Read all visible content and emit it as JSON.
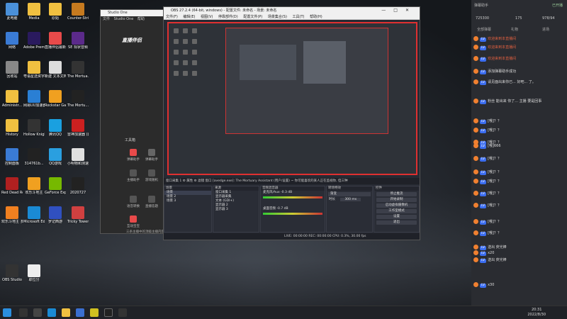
{
  "desktop_icons": [
    {
      "label": "此电脑",
      "color": "#4a90d9"
    },
    {
      "label": "Media",
      "color": "#f0c040"
    },
    {
      "label": "原始",
      "color": "#f0c040"
    },
    {
      "label": "Counter-Strike Global Off...",
      "color": "#c67a1f"
    },
    {
      "label": "网络",
      "color": "#3a7bd5"
    },
    {
      "label": "Adobe Premie...",
      "color": "#2a1a5e"
    },
    {
      "label": "直播伴侣最新",
      "color": "#e84a4a"
    },
    {
      "label": "SE 现状音频",
      "color": "#5b2a8a"
    },
    {
      "label": "回收站",
      "color": "#888888"
    },
    {
      "label": "粤语星选资字",
      "color": "#f0c040"
    },
    {
      "label": "新建 文本文档",
      "color": "#dddddd"
    },
    {
      "label": "The Mortua...",
      "color": "#333333"
    },
    {
      "label": "Administr...",
      "color": "#f0c040"
    },
    {
      "label": "网易UU加速器",
      "color": "#2a7fd4"
    },
    {
      "label": "Rockstar Games...",
      "color": "#f0a020"
    },
    {
      "label": "The Mortu...",
      "color": "#222222"
    },
    {
      "label": "History",
      "color": "#f0c040"
    },
    {
      "label": "Hollow Knight",
      "color": "#333333"
    },
    {
      "label": "腾讯QQ",
      "color": "#1aa0e0"
    },
    {
      "label": "雷神加速器 (网上科技)NLMA...",
      "color": "#cc2020"
    },
    {
      "label": "控制面板",
      "color": "#3a7bd5"
    },
    {
      "label": "314761b...",
      "color": "#222222"
    },
    {
      "label": "QQ游戏",
      "color": "#2a9fe0"
    },
    {
      "label": "小明物和测速",
      "color": "#e0e0e0"
    },
    {
      "label": "Red Dead Redempti...",
      "color": "#b02020"
    },
    {
      "label": "欢乐斗地主",
      "color": "#f0a020"
    },
    {
      "label": "GeForce Experience",
      "color": "#76b900"
    },
    {
      "label": "2020727",
      "color": "#222222"
    },
    {
      "label": "欢乐斗地主 多媒体版",
      "color": "#f08020"
    },
    {
      "label": "Microsoft Edge",
      "color": "#1a8ad4"
    },
    {
      "label": "罗记西游",
      "color": "#3050c0"
    },
    {
      "label": "Tricky Towers",
      "color": "#d04040"
    },
    {
      "label": "OBS Studio",
      "color": "#333333"
    },
    {
      "label": "职位分",
      "color": "#eeeeee"
    }
  ],
  "studio": {
    "title": "Studio One",
    "menu": [
      "文件",
      "Studio One",
      "帮助"
    ],
    "brand": "直播伴侣",
    "tools_title": "工具箱",
    "tools": [
      "弹幕助手",
      "弹幕助手",
      "主播助手",
      "游戏随机",
      "语音转换",
      "直播答题",
      "互动宝宝"
    ],
    "bottom_note": "三条主播中的顶级主播内容"
  },
  "obs": {
    "title": "OBS 27.2.4 (64-bit, windows) - 配置文件: 未命名 - 场景: 未命名",
    "menu": [
      "文件(F)",
      "编辑(E)",
      "视图(V)",
      "停靠部件(D)",
      "配置文件(P)",
      "场景集合(S)",
      "工具(T)",
      "帮助(H)"
    ],
    "ctrlbar": "窗口采集 1    ⚙ 属性    ⚙ 滤镜    窗口    [avedge.exe]: The Mortuary Assistant (用户/设置) ~ 你可能喜欢的某人正在监视你, 但三种",
    "dock_scenes": {
      "head": "场景",
      "items": [
        "场景",
        "场景 2",
        "场景 3"
      ]
    },
    "dock_sources": {
      "head": "来源",
      "items": [
        "窗口采集 1",
        "显示器采集",
        "文本 (GDI+)",
        "显示器 2",
        "显示器 3"
      ]
    },
    "dock_mixer": {
      "head": "音频混音器",
      "items": [
        "麦克风/Aux  -0.3 dB",
        "桌面音频  -0.7 dB"
      ]
    },
    "dock_transition": {
      "head": "转场特效",
      "fade": "渐变",
      "duration_label": "时长",
      "duration": "300 ms"
    },
    "dock_controls": {
      "head": "控件",
      "buttons": [
        "停止推流",
        "开始录制",
        "启动虚拟摄像机",
        "工作室模式",
        "设置",
        "退出"
      ]
    },
    "status": "LIVE: 00:00:00    REC: 00:00:00    CPU: 0.3%, 30.00 fps"
  },
  "side": {
    "title": "弹幕助手",
    "status_right": "已开播",
    "stats": [
      "725300",
      "175",
      "978/94"
    ],
    "tabs": [
      "全部弹幕",
      "礼物",
      "进场"
    ],
    "messages": [
      {
        "text": "欢迎来到本直播间",
        "color": "#e06040"
      },
      {
        "text": "欢迎来到本直播间",
        "color": "#e06040"
      },
      {
        "text": "欢迎来到本直播间",
        "color": "#e06040"
      },
      {
        "text": "添加弹幕助手成功",
        "color": "#dddddd"
      },
      {
        "text": "请见面出来你已... 好吧... 了。",
        "color": "#ddd"
      },
      {
        "text": "粉丝 能出来 你了... 主播 要是回事",
        "color": "#ddd"
      },
      {
        "text": "[哦]？？",
        "color": "#ddd"
      },
      {
        "text": "[哦]？？",
        "color": "#ddd"
      },
      {
        "text": "[哦]？？",
        "color": "#ddd"
      },
      {
        "text": "[哦]666",
        "color": "#ddd"
      },
      {
        "text": "[哦]？？",
        "color": "#ddd"
      },
      {
        "text": "[哦]？？",
        "color": "#ddd"
      },
      {
        "text": "[哦]？？",
        "color": "#ddd"
      },
      {
        "text": "[哦]？？",
        "color": "#ddd"
      },
      {
        "text": "[哦]？？",
        "color": "#ddd"
      },
      {
        "text": "[哦]？？",
        "color": "#ddd"
      },
      {
        "text": "[哦]？？",
        "color": "#ddd"
      },
      {
        "text": "送出 荧光棒",
        "color": "#ddd"
      },
      {
        "text": "x20",
        "color": "#ddd"
      },
      {
        "text": "送出 荧光棒",
        "color": "#ddd"
      },
      {
        "text": "x30",
        "color": "#ddd"
      }
    ]
  },
  "taskbar": {
    "time": "20:31",
    "date": "2022/8/30"
  }
}
